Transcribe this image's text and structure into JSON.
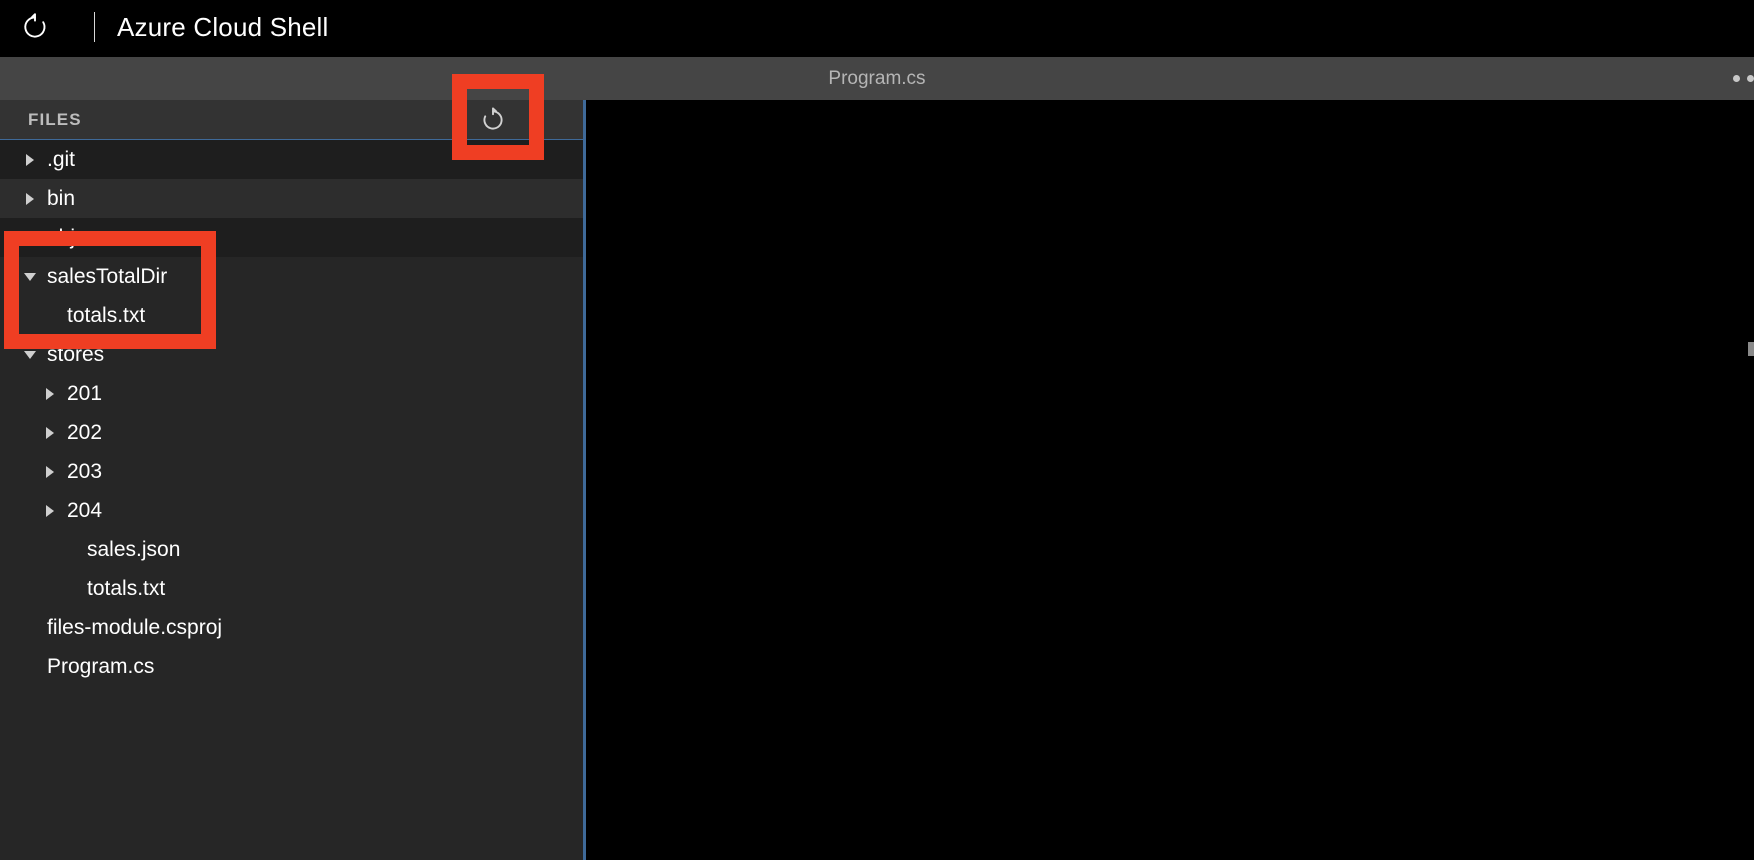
{
  "window": {
    "restart_icon": "restart-circular-arrow-icon",
    "separator": "|",
    "title": "Azure Cloud Shell"
  },
  "editor_tabstrip": {
    "active_tab": "Program.cs",
    "overflow_menu_icon": "ellipsis-icon"
  },
  "sidebar": {
    "header_label": "FILES",
    "refresh_icon": "refresh-icon",
    "tree": [
      {
        "label": ".git",
        "level": 1,
        "state": "collapsed",
        "type": "folder"
      },
      {
        "label": "bin",
        "level": 1,
        "state": "collapsed",
        "type": "folder"
      },
      {
        "label": "obj",
        "level": 1,
        "state": "collapsed",
        "type": "folder"
      },
      {
        "label": "salesTotalDir",
        "level": 1,
        "state": "expanded",
        "type": "folder"
      },
      {
        "label": "totals.txt",
        "level": 2,
        "state": "none",
        "type": "file"
      },
      {
        "label": "stores",
        "level": 1,
        "state": "expanded",
        "type": "folder"
      },
      {
        "label": "201",
        "level": 2,
        "state": "collapsed",
        "type": "folder"
      },
      {
        "label": "202",
        "level": 2,
        "state": "collapsed",
        "type": "folder"
      },
      {
        "label": "203",
        "level": 2,
        "state": "collapsed",
        "type": "folder"
      },
      {
        "label": "204",
        "level": 2,
        "state": "collapsed",
        "type": "folder"
      },
      {
        "label": "sales.json",
        "level": 3,
        "state": "none",
        "type": "file"
      },
      {
        "label": "totals.txt",
        "level": 3,
        "state": "none",
        "type": "file"
      },
      {
        "label": "files-module.csproj",
        "level": 1,
        "state": "none",
        "type": "file"
      },
      {
        "label": "Program.cs",
        "level": 1,
        "state": "none",
        "type": "file"
      }
    ]
  },
  "annotations": {
    "color": "#ef3e23",
    "boxes": [
      {
        "name": "refresh-button-highlight",
        "target": "refresh-icon"
      },
      {
        "name": "salesTotalDir-highlight",
        "target": "salesTotalDir / totals.txt"
      }
    ]
  },
  "colors": {
    "titlebar_bg": "#000000",
    "tabstrip_bg": "#454545",
    "sidebar_bg": "#262626",
    "sidebar_row_alt": "#1e1e1e",
    "sidebar_row_hover": "#2d2d2d",
    "files_header_bg": "#333333",
    "accent_blue": "#3f6a99",
    "editor_bg": "#000000",
    "annotation_red": "#ef3e23",
    "text_primary": "#ffffff",
    "text_muted": "#b5b5b5"
  }
}
